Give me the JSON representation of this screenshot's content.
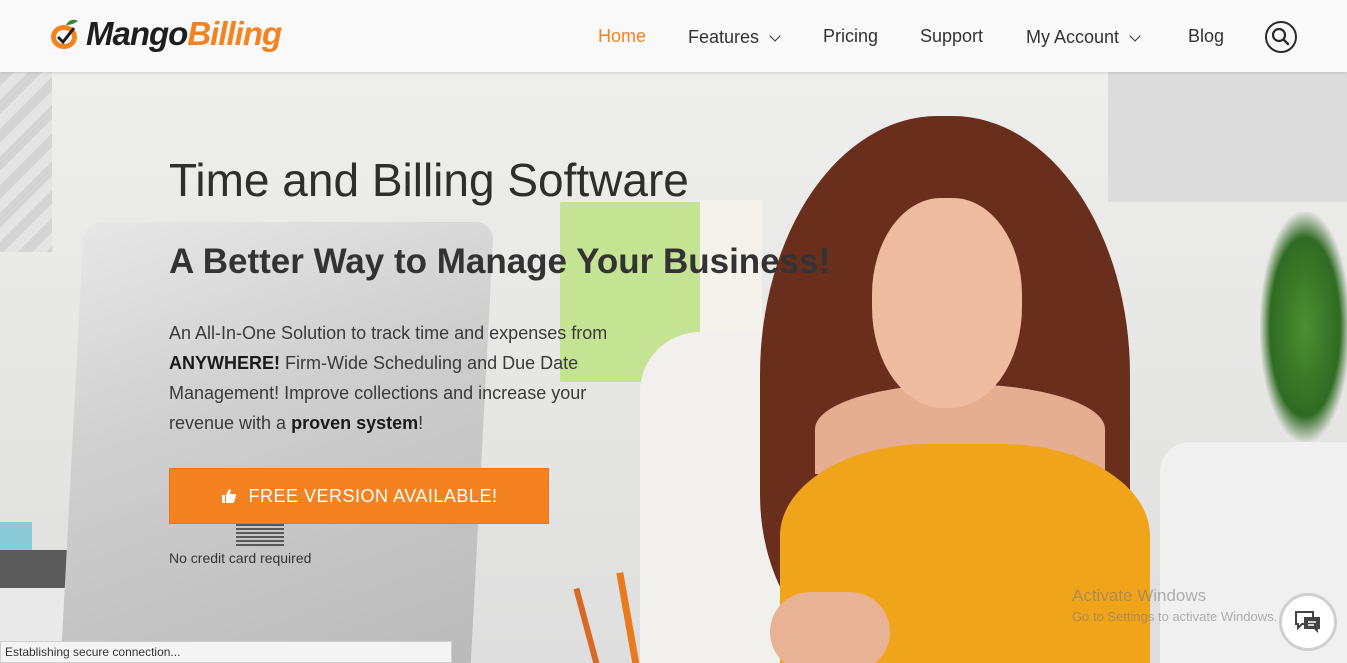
{
  "header": {
    "logo": {
      "mango": "Mango",
      "billing": "Billing"
    },
    "nav": [
      {
        "label": "Home",
        "active": true,
        "has_dropdown": false
      },
      {
        "label": "Features",
        "active": false,
        "has_dropdown": true
      },
      {
        "label": "Pricing",
        "active": false,
        "has_dropdown": false
      },
      {
        "label": "Support",
        "active": false,
        "has_dropdown": false
      },
      {
        "label": "My Account",
        "active": false,
        "has_dropdown": true
      },
      {
        "label": "Blog",
        "active": false,
        "has_dropdown": false
      }
    ],
    "search_icon": "search-icon"
  },
  "hero": {
    "title": "Time and Billing Software",
    "subtitle": "A Better Way to Manage Your Business!",
    "body": {
      "p1": "An ",
      "b1": "All-In-One Solution",
      "p2": " to track time and expenses from ",
      "b2": "ANYWHERE!",
      "p3": "  Firm-Wide Scheduling and Due Date Management!  Improve collections and increase your revenue with a ",
      "b3": "proven system",
      "p4": "!"
    },
    "cta_label": "FREE VERSION AVAILABLE!",
    "cta_icon": "thumbs-up-icon",
    "cta_note": "No credit card required"
  },
  "status_bar": "Establishing secure connection...",
  "windows_watermark": {
    "title": "Activate Windows",
    "subtitle": "Go to Settings to activate Windows."
  },
  "chat_icon": "chat-icon",
  "colors": {
    "accent": "#f58220",
    "text": "#333333",
    "header_bg": "#f9f9f9"
  }
}
